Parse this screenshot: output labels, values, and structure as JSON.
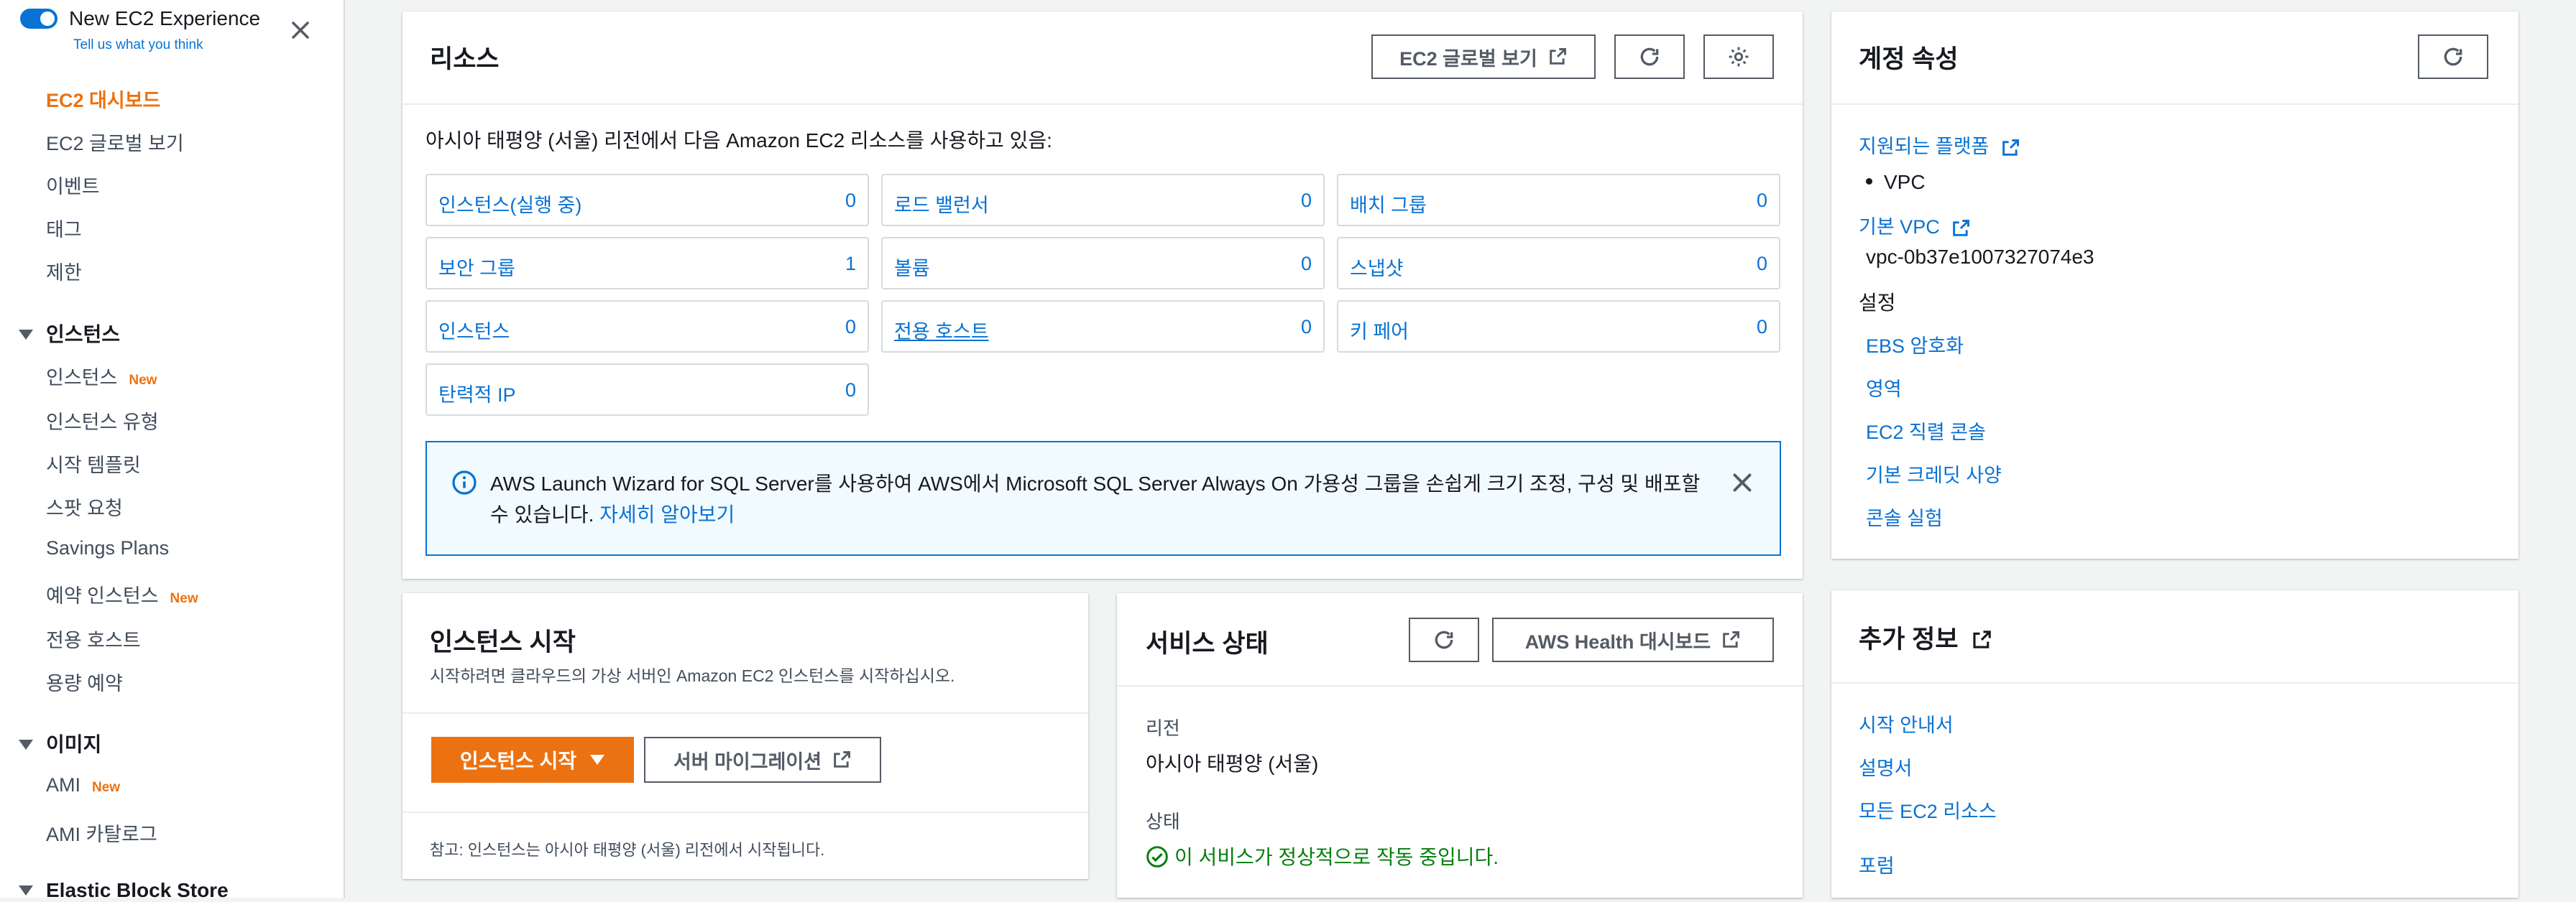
{
  "sidebar": {
    "toggle_title": "New EC2 Experience",
    "toggle_sub": "Tell us what you think",
    "items": [
      {
        "label": "EC2 대시보드"
      },
      {
        "label": "EC2 글로벌 보기"
      },
      {
        "label": "이벤트"
      },
      {
        "label": "태그"
      },
      {
        "label": "제한"
      }
    ],
    "sections": [
      {
        "title": "인스턴스",
        "items": [
          {
            "label": "인스턴스",
            "badge": "New"
          },
          {
            "label": "인스턴스 유형"
          },
          {
            "label": "시작 템플릿"
          },
          {
            "label": "스팟 요청"
          },
          {
            "label": "Savings Plans"
          },
          {
            "label": "예약 인스턴스",
            "badge": "New"
          },
          {
            "label": "전용 호스트"
          },
          {
            "label": "용량 예약"
          }
        ]
      },
      {
        "title": "이미지",
        "items": [
          {
            "label": "AMI",
            "badge": "New"
          },
          {
            "label": "AMI 카탈로그"
          }
        ]
      },
      {
        "title": "Elastic Block Store",
        "items": []
      }
    ]
  },
  "resources": {
    "title": "리소스",
    "global_button": "EC2 글로벌 보기",
    "intro": "아시아 태평양 (서울) 리전에서 다음 Amazon EC2 리소스를 사용하고 있음:",
    "cards": [
      {
        "label": "인스턴스(실행 중)",
        "count": "0"
      },
      {
        "label": "로드 밸런서",
        "count": "0"
      },
      {
        "label": "배치 그룹",
        "count": "0"
      },
      {
        "label": "보안 그룹",
        "count": "1"
      },
      {
        "label": "볼륨",
        "count": "0"
      },
      {
        "label": "스냅샷",
        "count": "0"
      },
      {
        "label": "인스턴스",
        "count": "0"
      },
      {
        "label": "전용 호스트",
        "count": "0"
      },
      {
        "label": "키 페어",
        "count": "0"
      },
      {
        "label": "탄력적 IP",
        "count": "0"
      }
    ],
    "banner_text": "AWS Launch Wizard for SQL Server를 사용하여 AWS에서 Microsoft SQL Server Always On 가용성 그룹을 손쉽게 크기 조정, 구성 및 배포할 수 있습니다. ",
    "banner_link": "자세히 알아보기"
  },
  "account": {
    "title": "계정 속성",
    "platforms_link": "지원되는 플랫폼",
    "platform_item": "VPC",
    "default_vpc_link": "기본 VPC",
    "vpc_id": "vpc-0b37e1007327074e3",
    "settings_label": "설정",
    "settings_links": [
      "EBS 암호화",
      "영역",
      "EC2 직렬 콘솔",
      "기본 크레딧 사양",
      "콘솔 실험"
    ]
  },
  "launch": {
    "title": "인스턴스 시작",
    "desc": "시작하려면 클라우드의 가상 서버인 Amazon EC2 인스턴스를 시작하십시오.",
    "launch_button": "인스턴스 시작",
    "migrate_button": "서버 마이그레이션",
    "note": "참고: 인스턴스는 아시아 태평양 (서울) 리전에서 시작됩니다."
  },
  "service": {
    "title": "서비스 상태",
    "health_button": "AWS Health 대시보드",
    "region_label": "리전",
    "region_value": "아시아 태평양 (서울)",
    "status_label": "상태",
    "status_value": "이 서비스가 정상적으로 작동 중입니다."
  },
  "extra": {
    "title": "추가 정보",
    "links": [
      "시작 안내서",
      "설명서",
      "모든 EC2 리소스",
      "포럼"
    ]
  },
  "colors": {
    "accent": "#ec7211",
    "link": "#0972d3",
    "success": "#037f0c"
  }
}
